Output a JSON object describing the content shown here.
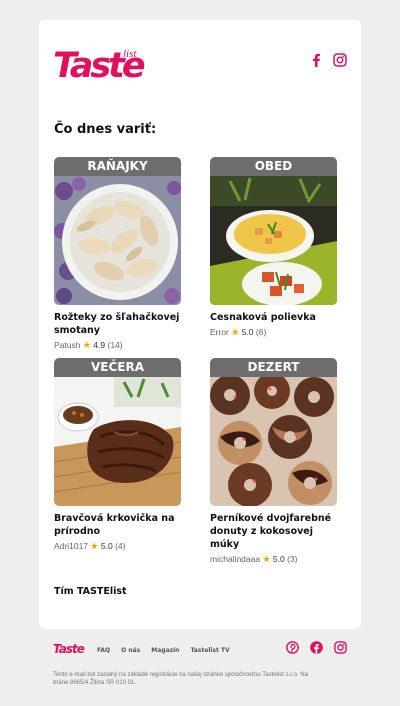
{
  "brand": {
    "logo_main": "Taste",
    "logo_small": "list",
    "accent": "#e0105d"
  },
  "social_top": {
    "facebook_icon": "facebook-icon",
    "instagram_icon": "instagram-icon"
  },
  "heading": "Čo dnes variť:",
  "recipes": [
    {
      "category": "RAŇAJKY",
      "title": "Rožteky zo šľahačkovej smotany",
      "author": "Patush",
      "rating": "4.9",
      "count": "(14)"
    },
    {
      "category": "OBED",
      "title": "Cesnaková polievka",
      "author": "Error",
      "rating": "5.0",
      "count": "(6)"
    },
    {
      "category": "VEČERA",
      "title": "Bravčová krkovička na prírodno",
      "author": "Adri1017",
      "rating": "5.0",
      "count": "(4)"
    },
    {
      "category": "DEZERT",
      "title": "Perníkové dvojfarebné donuty z kokosovej múky",
      "author": "michalindaaa",
      "rating": "5.0",
      "count": "(3)"
    }
  ],
  "signature": "Tím TASTElist",
  "footer": {
    "logo": "Taste",
    "nav": [
      "FAQ",
      "O nás",
      "Magazín",
      "Tastelist TV"
    ],
    "disclaimer": "Tento e-mail bol zaslaný na základe registrácie na našej stránke spoločnosťou Tastelist s.r.o. Na bráne 8665/4 Žilina SR 010 01."
  }
}
